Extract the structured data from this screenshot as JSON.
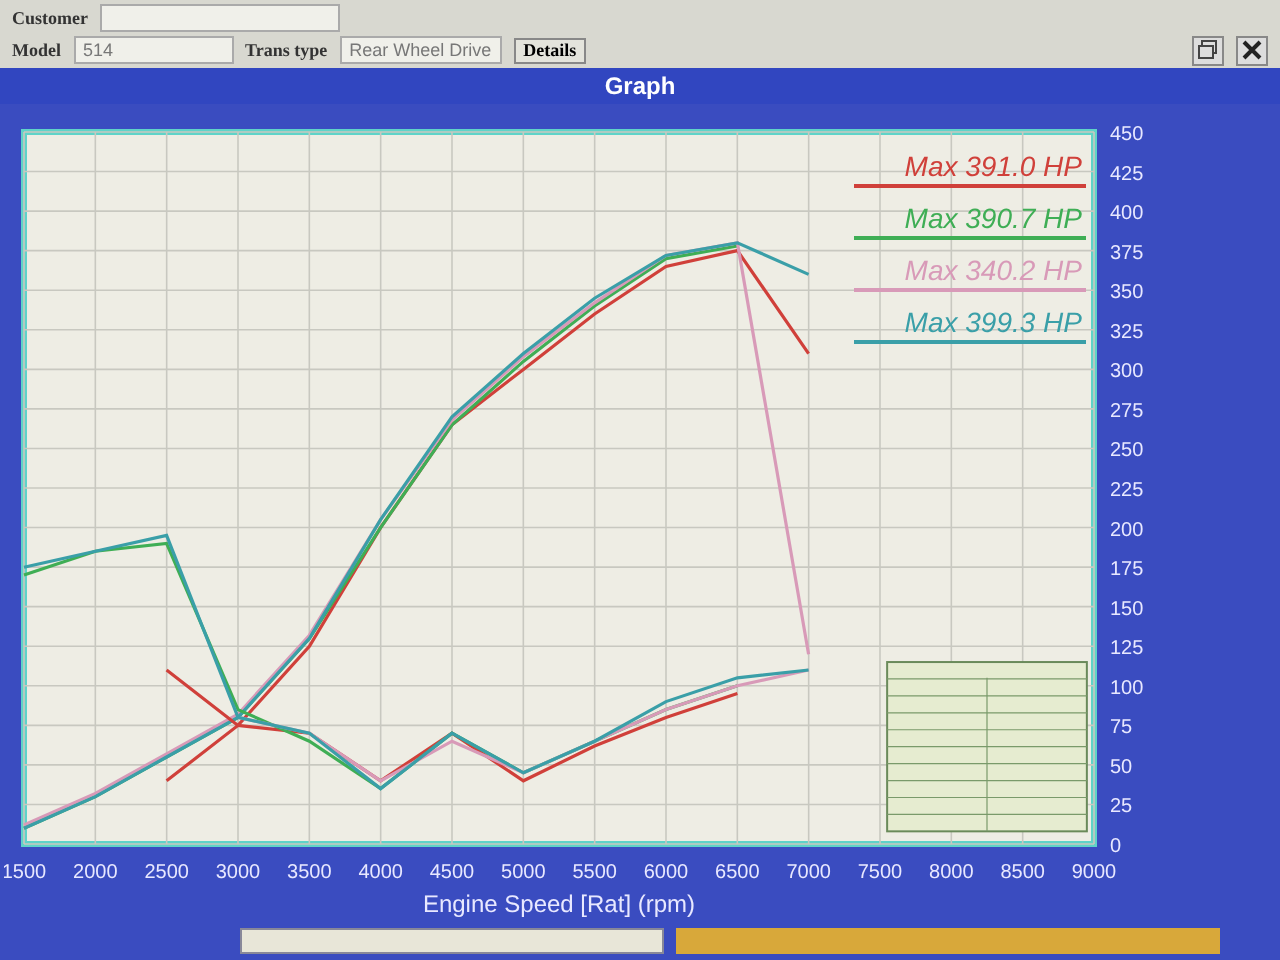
{
  "form": {
    "customer_label": "Customer",
    "model_label": "Model",
    "model_value": "514",
    "trans_label": "Trans type",
    "trans_value": "Rear Wheel Drive",
    "details_button": "Details"
  },
  "window": {
    "title": "Graph"
  },
  "graph": {
    "chart_data": {
      "type": "line",
      "grid": true,
      "xlabel": "Engine Speed [Rat] (rpm)",
      "x": [
        1500,
        2000,
        2500,
        3000,
        3500,
        4000,
        4500,
        5000,
        5500,
        6000,
        6500,
        7000
      ],
      "xlim": [
        1500,
        9000
      ],
      "ylim": [
        0,
        450
      ],
      "xticks": [
        1500,
        2000,
        2500,
        3000,
        3500,
        4000,
        4500,
        5000,
        5500,
        6000,
        6500,
        7000,
        7500,
        8000,
        8500,
        9000
      ],
      "yticks": [
        0,
        25,
        50,
        75,
        100,
        125,
        150,
        175,
        200,
        225,
        250,
        275,
        300,
        325,
        350,
        375,
        400,
        425,
        450
      ],
      "series": [
        {
          "name": "Max 391.0 HP",
          "color": "#d0403a",
          "values": [
            null,
            null,
            40,
            75,
            125,
            200,
            265,
            300,
            335,
            365,
            375,
            310
          ]
        },
        {
          "name": "Max 390.7 HP",
          "color": "#3fae55",
          "values": [
            10,
            30,
            55,
            80,
            130,
            200,
            265,
            305,
            340,
            370,
            378,
            null
          ]
        },
        {
          "name": "Max 340.2 HP",
          "color": "#d89ab8",
          "values": [
            12,
            32,
            57,
            82,
            132,
            205,
            268,
            308,
            342,
            372,
            380,
            120
          ]
        },
        {
          "name": "Max 399.3 HP",
          "color": "#3a9fa8",
          "values": [
            10,
            30,
            55,
            80,
            130,
            205,
            270,
            310,
            345,
            372,
            380,
            360
          ]
        }
      ]
    }
  },
  "lower_curves": {
    "chart_data": {
      "type": "line",
      "x": [
        1500,
        2000,
        2500,
        3000,
        3500,
        4000,
        4500,
        5000,
        5500,
        6000,
        6500,
        7000
      ],
      "xlim": [
        1500,
        9000
      ],
      "ylim": [
        0,
        450
      ],
      "series": [
        {
          "color": "#d0403a",
          "values": [
            null,
            null,
            110,
            75,
            70,
            40,
            70,
            40,
            62,
            80,
            95,
            null
          ]
        },
        {
          "color": "#3fae55",
          "values": [
            170,
            185,
            190,
            85,
            65,
            35,
            70,
            45,
            65,
            85,
            100,
            null
          ]
        },
        {
          "color": "#d89ab8",
          "values": [
            null,
            null,
            null,
            80,
            70,
            40,
            65,
            45,
            65,
            85,
            100,
            110
          ]
        },
        {
          "color": "#3a9fa8",
          "values": [
            175,
            185,
            195,
            80,
            70,
            35,
            70,
            45,
            65,
            90,
            105,
            110
          ]
        }
      ]
    }
  }
}
